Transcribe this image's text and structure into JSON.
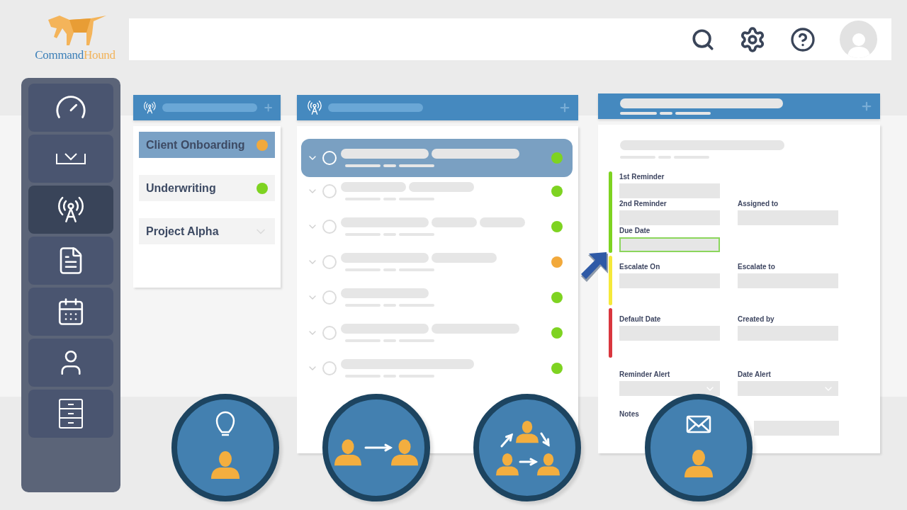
{
  "logo": {
    "name_first": "Command",
    "name_second": "Hound"
  },
  "sidebar": {
    "items": [
      {
        "selected": false
      },
      {
        "selected": false
      },
      {
        "selected": true
      },
      {
        "selected": false
      },
      {
        "selected": false
      },
      {
        "selected": false
      },
      {
        "selected": false
      }
    ]
  },
  "projects": {
    "items": [
      {
        "label": "Client Onboarding",
        "selected": true,
        "kind": "status",
        "color": "#f2a93b"
      },
      {
        "label": "Underwriting",
        "selected": false,
        "kind": "status",
        "color": "#7ed321"
      },
      {
        "label": "Project Alpha",
        "selected": false,
        "kind": "collapsed"
      }
    ]
  },
  "tasks": {
    "rows": [
      {
        "selected": true,
        "color": "#7ed321"
      },
      {
        "selected": false,
        "color": "#7ed321"
      },
      {
        "selected": false,
        "color": "#7ed321"
      },
      {
        "selected": false,
        "color": "#f2a93b"
      },
      {
        "selected": false,
        "color": "#7ed321"
      },
      {
        "selected": false,
        "color": "#7ed321"
      },
      {
        "selected": false,
        "color": "#7ed321"
      }
    ]
  },
  "form": {
    "sections": [
      {
        "color": "#7ed321",
        "rows": [
          [
            {
              "label": "1st Reminder",
              "kind": "input",
              "focused": false
            }
          ],
          [
            {
              "label": "2nd Reminder",
              "kind": "input",
              "focused": false
            },
            {
              "label": "Assigned to",
              "kind": "input",
              "focused": false
            }
          ],
          [
            {
              "label": "Due Date",
              "kind": "input",
              "focused": true
            }
          ]
        ]
      },
      {
        "color": "#f5e93a",
        "rows": [
          [
            {
              "label": "Escalate On",
              "kind": "input",
              "focused": false
            },
            {
              "label": "Escalate to",
              "kind": "input",
              "focused": false
            }
          ]
        ]
      },
      {
        "color": "#d9363e",
        "rows": [
          [
            {
              "label": "Default Date",
              "kind": "input",
              "focused": false
            },
            {
              "label": "Created by",
              "kind": "input",
              "focused": false
            }
          ]
        ]
      },
      {
        "rows": [
          [
            {
              "label": "Reminder Alert",
              "kind": "select",
              "focused": false
            },
            {
              "label": "Date Alert",
              "kind": "select",
              "focused": false
            }
          ],
          [
            {
              "label": "Notes",
              "kind": "wide",
              "focused": false
            }
          ]
        ]
      }
    ]
  },
  "badges": [
    {
      "kind": "idea"
    },
    {
      "kind": "handoff"
    },
    {
      "kind": "cycle"
    },
    {
      "kind": "notify"
    }
  ]
}
